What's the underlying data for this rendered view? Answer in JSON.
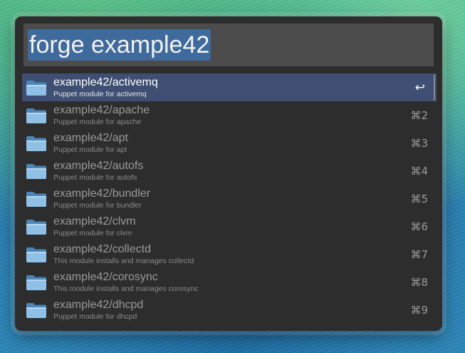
{
  "search": {
    "query": "forge example42"
  },
  "results": [
    {
      "title": "example42/activemq",
      "subtitle": "Puppet module for activemq",
      "shortcut": "↩",
      "selected": true
    },
    {
      "title": "example42/apache",
      "subtitle": "Puppet module for apache",
      "shortcut": "⌘2"
    },
    {
      "title": "example42/apt",
      "subtitle": "Puppet module for apt",
      "shortcut": "⌘3"
    },
    {
      "title": "example42/autofs",
      "subtitle": "Puppet module for autofs",
      "shortcut": "⌘4"
    },
    {
      "title": "example42/bundler",
      "subtitle": "Puppet module for bundler",
      "shortcut": "⌘5"
    },
    {
      "title": "example42/clvm",
      "subtitle": "Puppet module for clvm",
      "shortcut": "⌘6"
    },
    {
      "title": "example42/collectd",
      "subtitle": "This module installs and manages collectd",
      "shortcut": "⌘7"
    },
    {
      "title": "example42/corosync",
      "subtitle": "This module installs and manages corosync",
      "shortcut": "⌘8"
    },
    {
      "title": "example42/dhcpd",
      "subtitle": "Puppet module for dhcpd",
      "shortcut": "⌘9"
    }
  ],
  "icons": {
    "result_icon": "folder-icon"
  },
  "colors": {
    "selection": "#3e4f73",
    "query_highlight": "#3f6a9c",
    "window_bg": "#2d2d2d",
    "field_bg": "#4c4c4c"
  }
}
